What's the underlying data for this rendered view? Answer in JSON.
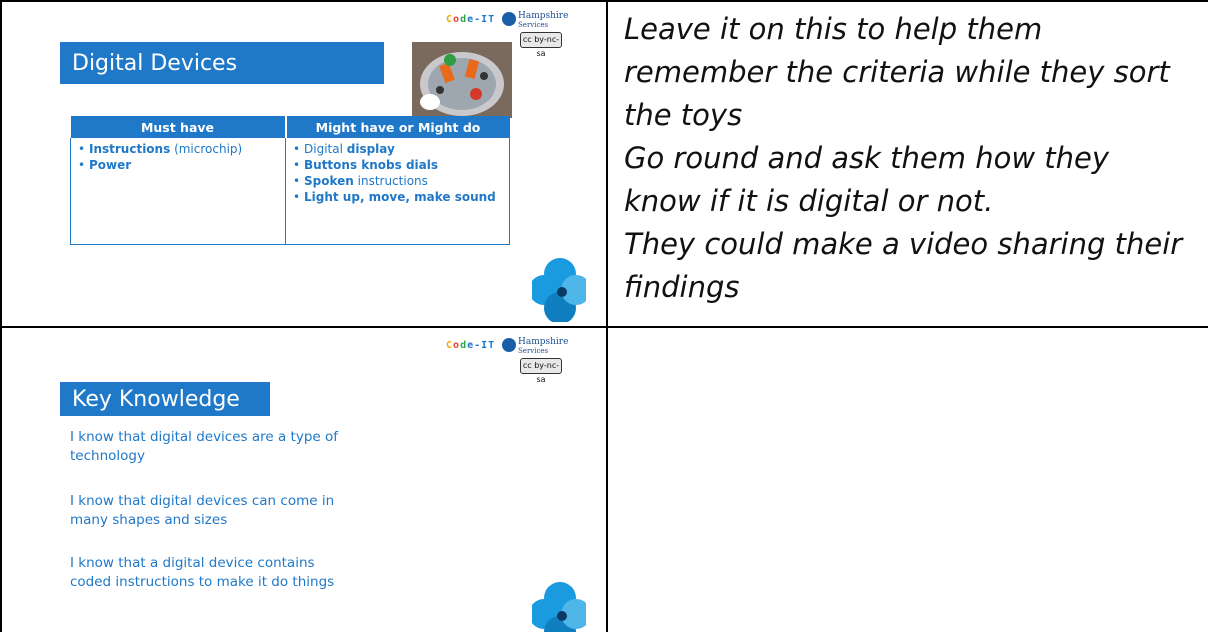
{
  "slide1": {
    "title": "Digital Devices",
    "logo_code": [
      "C",
      "o",
      "d",
      "e",
      "-IT"
    ],
    "logo_org": "Hampshire",
    "logo_org_sub": "Services",
    "cc_badge": "cc by-nc-sa",
    "table": {
      "headers": [
        "Must have",
        "Might have or Might do"
      ],
      "must_have": [
        {
          "bold": "Instructions",
          "rest": " (microchip)"
        },
        {
          "bold": "Power",
          "rest": ""
        }
      ],
      "might_have": [
        {
          "pre": "Digital ",
          "bold": "display",
          "rest": ""
        },
        {
          "pre": "",
          "bold": "Buttons knobs dials",
          "rest": ""
        },
        {
          "pre": "",
          "bold": "Spoken",
          "rest": " instructions"
        },
        {
          "pre": "",
          "bold": "Light up, move, make sound",
          "rest": ""
        }
      ]
    }
  },
  "notes1": {
    "lines": [
      "Leave it on this to help them",
      "remember the criteria while they sort",
      "the toys",
      "Go round and ask them how they",
      "know if it is digital or not.",
      "They could make a video sharing their",
      "findings"
    ]
  },
  "slide2": {
    "title": "Key Knowledge",
    "logo_code": [
      "C",
      "o",
      "d",
      "e",
      "-IT"
    ],
    "logo_org": "Hampshire",
    "logo_org_sub": "Services",
    "cc_badge": "cc by-nc-sa",
    "points": [
      [
        "I know that digital devices are a type of",
        "technology"
      ],
      [
        "I know that digital devices can come in",
        "many shapes and sizes"
      ],
      [
        "I know that a digital device contains",
        "coded instructions to make it do things"
      ]
    ]
  },
  "notes2": {
    "lines": []
  },
  "colors": {
    "slide_blue": "#1f78c8",
    "flower_blue": "#1a9be0",
    "rule": "#000000"
  }
}
